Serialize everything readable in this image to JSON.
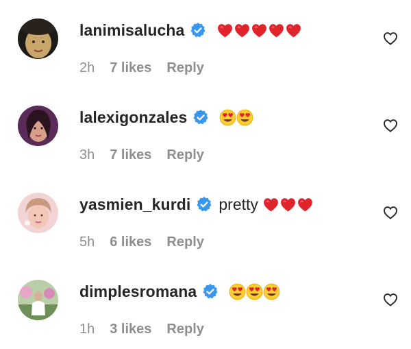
{
  "comments": [
    {
      "username": "lanimisalucha",
      "text": "",
      "emojis": [
        "heart",
        "heart",
        "heart",
        "heart",
        "heart"
      ],
      "time": "2h",
      "likes": "7 likes",
      "reply": "Reply",
      "avatar_color": "#c8a66a"
    },
    {
      "username": "lalexigonzales",
      "text": "",
      "emojis": [
        "heart-eyes",
        "heart-eyes"
      ],
      "time": "3h",
      "likes": "7 likes",
      "reply": "Reply",
      "avatar_color": "#7a3a6a"
    },
    {
      "username": "yasmien_kurdi",
      "text": "pretty",
      "emojis": [
        "heart",
        "heart",
        "heart"
      ],
      "time": "5h",
      "likes": "6 likes",
      "reply": "Reply",
      "avatar_color": "#e8b5b5"
    },
    {
      "username": "dimplesromana",
      "text": "",
      "emojis": [
        "heart-eyes",
        "heart-eyes",
        "heart-eyes"
      ],
      "time": "1h",
      "likes": "3 likes",
      "reply": "Reply",
      "avatar_color": "#8fae7a"
    }
  ],
  "colors": {
    "verified": "#3897f0",
    "meta": "#8e8e8e",
    "text": "#262626",
    "heart_emoji": "#e0242b"
  },
  "icons": {
    "verified": "verified-badge-icon",
    "like": "heart-outline-icon"
  }
}
